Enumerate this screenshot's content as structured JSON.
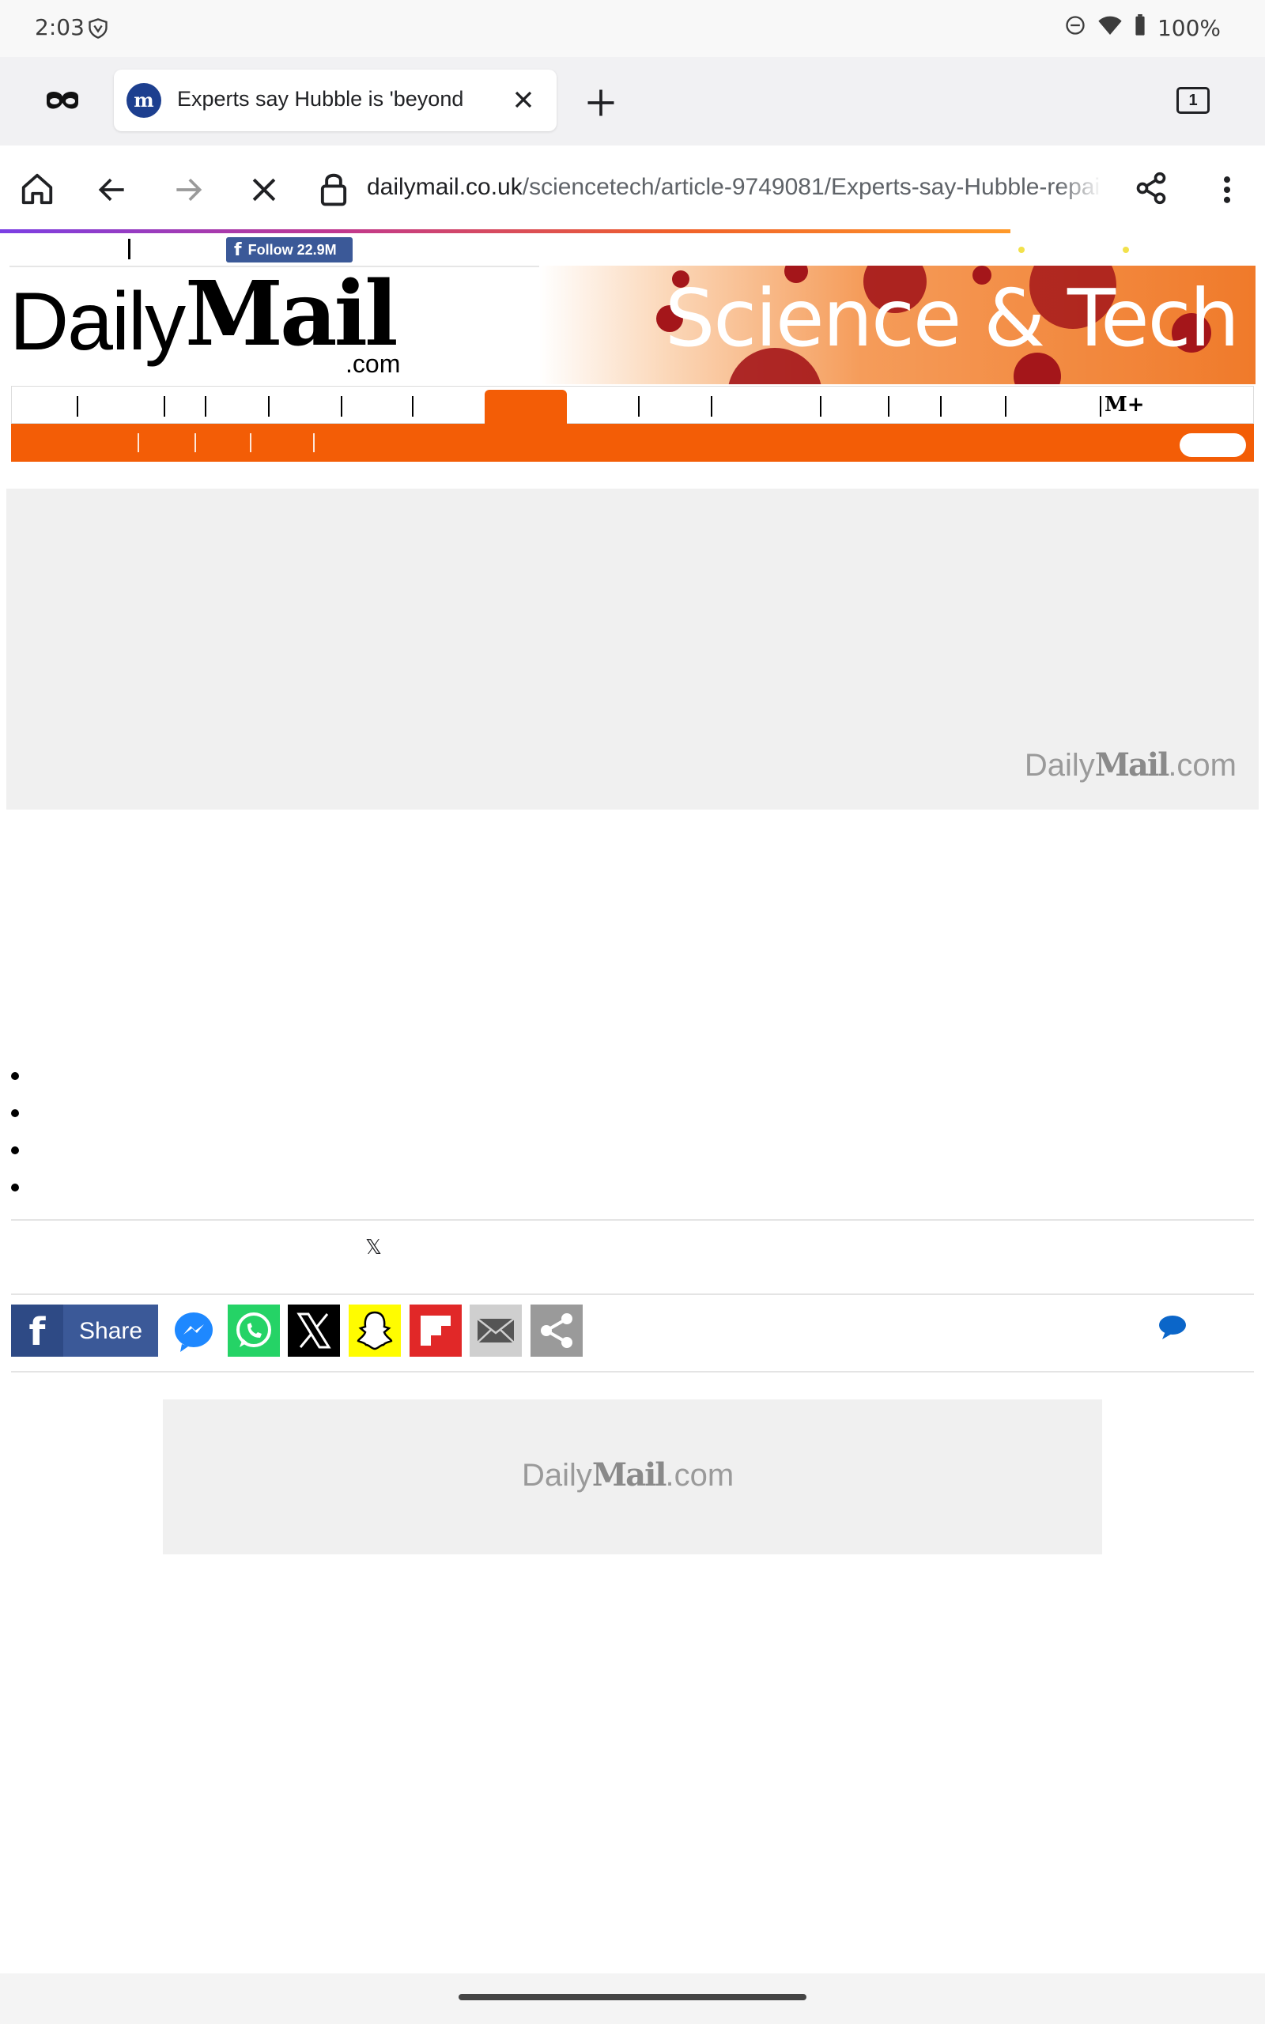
{
  "status_bar": {
    "time": "2:03",
    "battery": "100%"
  },
  "browser": {
    "tab_title": "Experts say Hubble is 'beyond",
    "tab_count": "1",
    "url_domain": "dailymail.co.uk",
    "url_path": "/sciencetech/article-9749081/Experts-say-Hubble-repai"
  },
  "page": {
    "follow_button": "Follow 22.9M",
    "logo_daily": "Daily",
    "logo_mail": "Mail",
    "logo_com": ".com",
    "section_banner": "Science & Tech",
    "mail_plus": "M+",
    "ad_logo_daily": "Daily",
    "ad_logo_mail": "Mail",
    "ad_logo_com": ".com",
    "share_label": "Share",
    "x_mark": "𝕏"
  },
  "colors": {
    "brand_orange": "#f35d06",
    "facebook_blue": "#3b5998",
    "messenger_blue": "#1e88ff",
    "whatsapp_green": "#25d366",
    "snapchat_yellow": "#fffc00",
    "flipboard_red": "#e12828",
    "comment_blue": "#0b66c9"
  },
  "icons": {
    "incognito": "incognito-mask-icon",
    "home": "home-icon",
    "back": "back-arrow-icon",
    "forward": "forward-arrow-icon",
    "stop": "stop-loading-icon",
    "lock": "lock-icon",
    "share": "share-icon",
    "menu": "more-vert-icon",
    "new_tab": "plus-icon",
    "comments": "comment-bubble-icon"
  }
}
